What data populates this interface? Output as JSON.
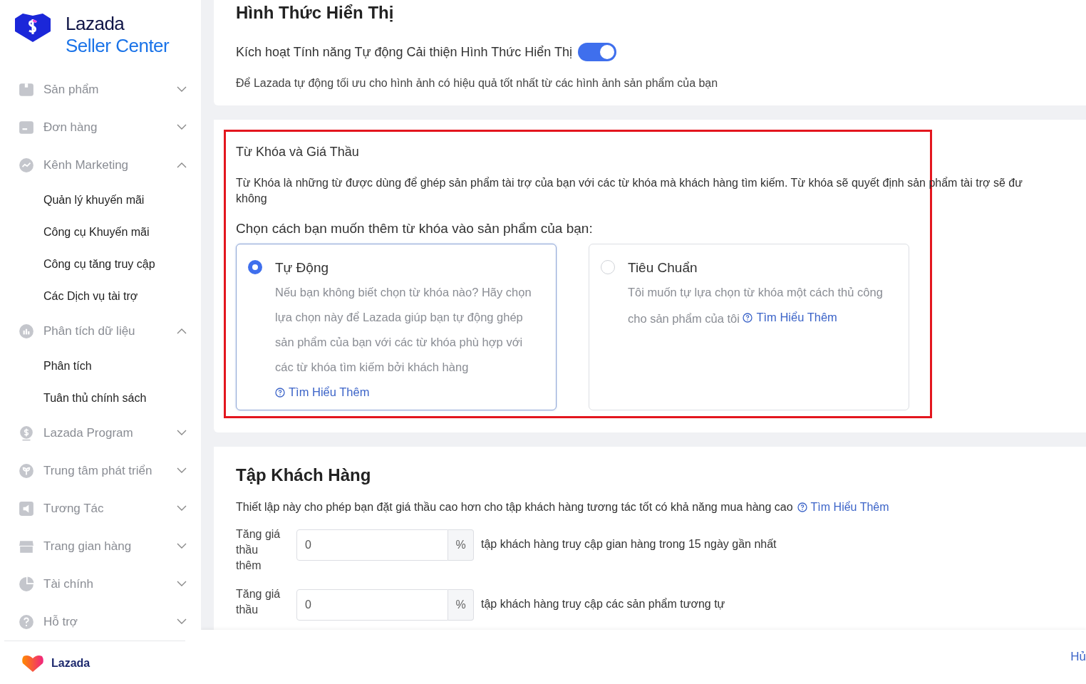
{
  "brand": {
    "name": "Lazada",
    "product": "Seller Center"
  },
  "sidebar": {
    "items": [
      {
        "label": "Sản phẩm",
        "expanded": false
      },
      {
        "label": "Đơn hàng",
        "expanded": false
      },
      {
        "label": "Kênh Marketing",
        "expanded": true,
        "children": [
          {
            "label": "Quản lý khuyến mãi"
          },
          {
            "label": "Công cụ Khuyến mãi"
          },
          {
            "label": "Công cụ tăng truy cập"
          },
          {
            "label": "Các Dịch vụ tài trợ"
          }
        ]
      },
      {
        "label": "Phân tích dữ liệu",
        "expanded": true,
        "children": [
          {
            "label": "Phân tích"
          },
          {
            "label": "Tuân thủ chính sách"
          }
        ]
      },
      {
        "label": "Lazada Program",
        "expanded": false
      },
      {
        "label": "Trung tâm phát triển",
        "expanded": false
      },
      {
        "label": "Tương Tác",
        "expanded": false
      },
      {
        "label": "Trang gian hàng",
        "expanded": false
      },
      {
        "label": "Tài chính",
        "expanded": false
      },
      {
        "label": "Hỗ trợ",
        "expanded": false
      }
    ],
    "footer_brand": "Lazada"
  },
  "display_section": {
    "title": "Hình Thức Hiển Thị",
    "toggle_label": "Kích hoạt Tính năng Tự động Cải thiện Hình Thức Hiển Thị",
    "toggle_on": true,
    "description": "Để Lazada tự động tối ưu cho hình ảnh có hiệu quả tốt nhất từ các hình ảnh sản phẩm của bạn"
  },
  "keyword_section": {
    "highlighted": true,
    "title": "Từ Khóa và Giá Thầu",
    "description_lines": [
      "Từ Khóa là những từ được dùng để ghép sản phẩm tài trợ của bạn với các từ khóa mà khách hàng tìm kiếm. Từ khóa sẽ quyết định sản phẩm tài trợ sẽ đư",
      "không"
    ],
    "question": "Chọn cách bạn muốn thêm từ khóa vào sản phẩm của bạn:",
    "options": [
      {
        "title": "Tự Động",
        "selected": true,
        "description": "Nếu bạn không biết chọn từ khóa nào? Hãy chọn lựa chọn này để Lazada giúp bạn tự động ghép sản phẩm của bạn với các từ khóa phù hợp với các từ khóa tìm kiếm bởi khách hàng",
        "link": "Tìm Hiểu Thêm"
      },
      {
        "title": "Tiêu Chuẩn",
        "selected": false,
        "description": "Tôi muốn tự lựa chọn từ khóa một cách thủ công cho sản phẩm của tôi",
        "link": "Tìm Hiểu Thêm"
      }
    ]
  },
  "audience_section": {
    "title": "Tập Khách Hàng",
    "description": "Thiết lập này cho phép bạn đặt giá thầu cao hơn cho tập khách hàng tương tác tốt có khả năng mua hàng cao",
    "link": "Tìm Hiểu Thêm",
    "rows": [
      {
        "label": "Tăng giá thầu thêm",
        "value": "0",
        "unit": "%",
        "description": "tập khách hàng truy cập gian hàng trong 15 ngày gần nhất"
      },
      {
        "label": "Tăng giá thầu",
        "value": "0",
        "unit": "%",
        "description": "tập khách hàng truy cập các sản phẩm tương tự"
      }
    ]
  },
  "footer": {
    "cancel": "Hủ"
  }
}
